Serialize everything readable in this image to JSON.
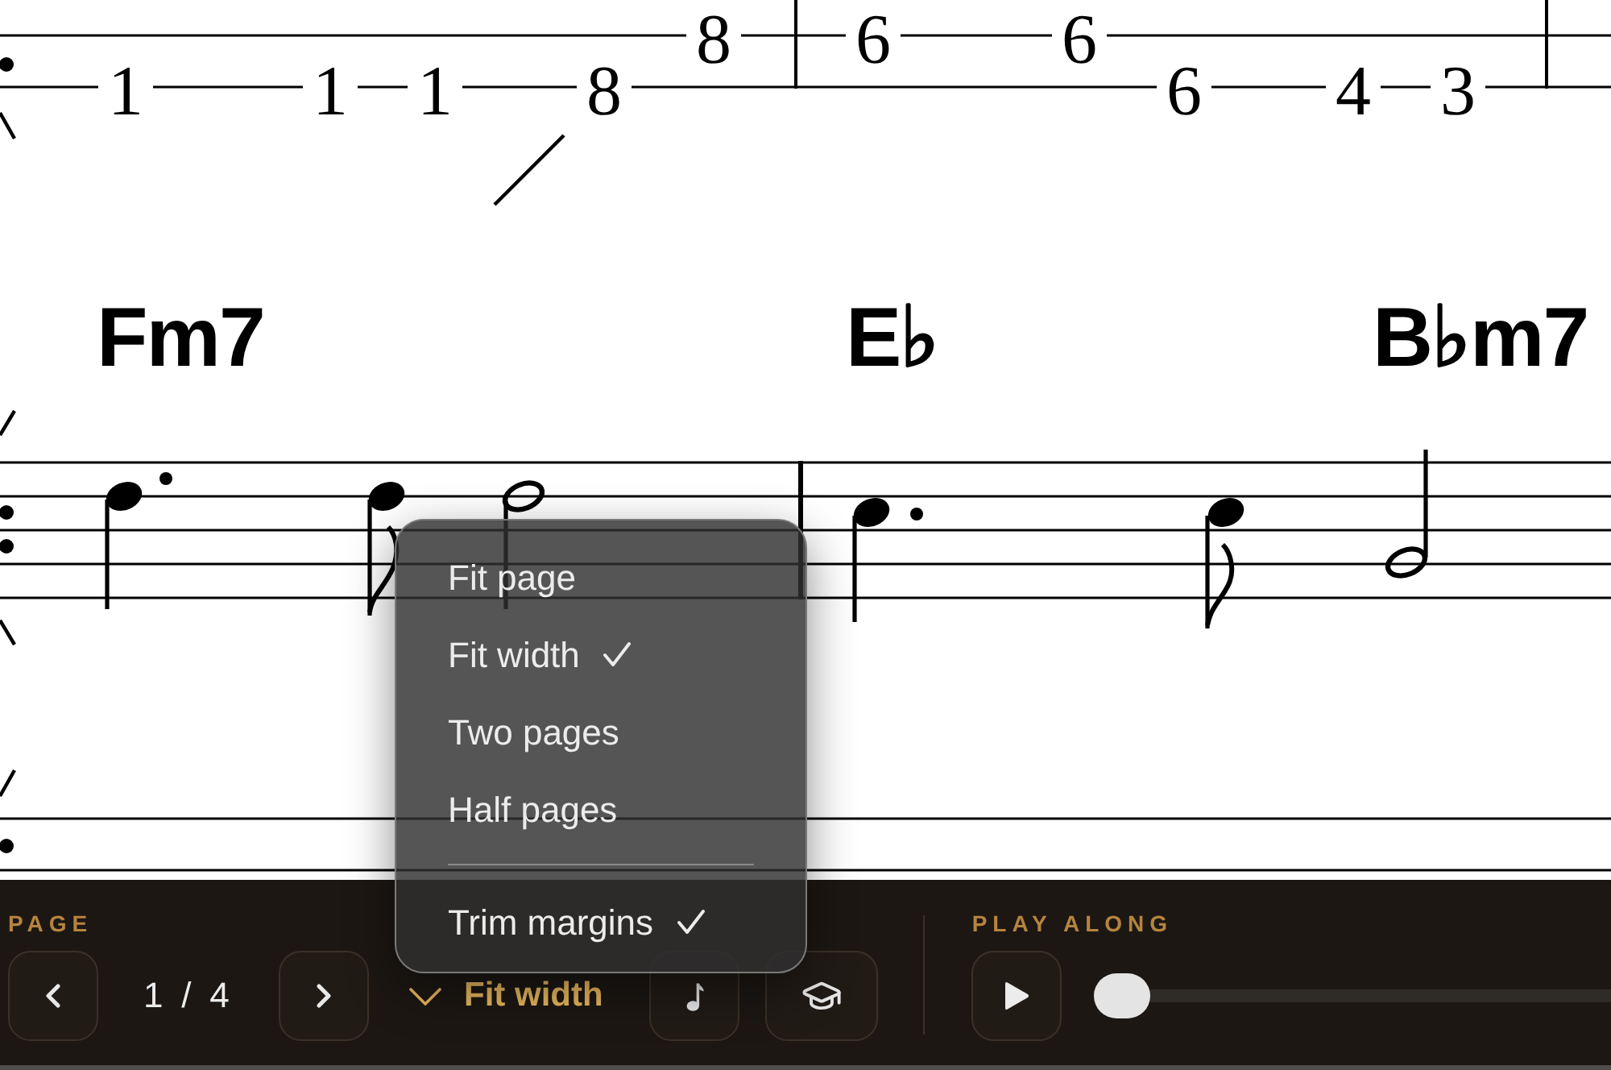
{
  "score": {
    "tab_numbers": [
      "1",
      "1",
      "1",
      "8",
      "8",
      "6",
      "6",
      "6",
      "4",
      "3"
    ],
    "chords": [
      "Fm7",
      "E♭",
      "B♭m7"
    ]
  },
  "zoom_menu": {
    "options": [
      {
        "label": "Fit page",
        "checked": false
      },
      {
        "label": "Fit width",
        "checked": true
      },
      {
        "label": "Two pages",
        "checked": false
      },
      {
        "label": "Half pages",
        "checked": false
      }
    ],
    "toggles": [
      {
        "label": "Trim margins",
        "checked": true
      }
    ]
  },
  "toolbar": {
    "page": {
      "label": "PAGE",
      "indicator": "1 / 4"
    },
    "zoom_dropdown": {
      "value": "Fit width",
      "expanded": true
    },
    "play_along": {
      "label": "PLAY ALONG",
      "playing": false,
      "level": 0
    }
  }
}
